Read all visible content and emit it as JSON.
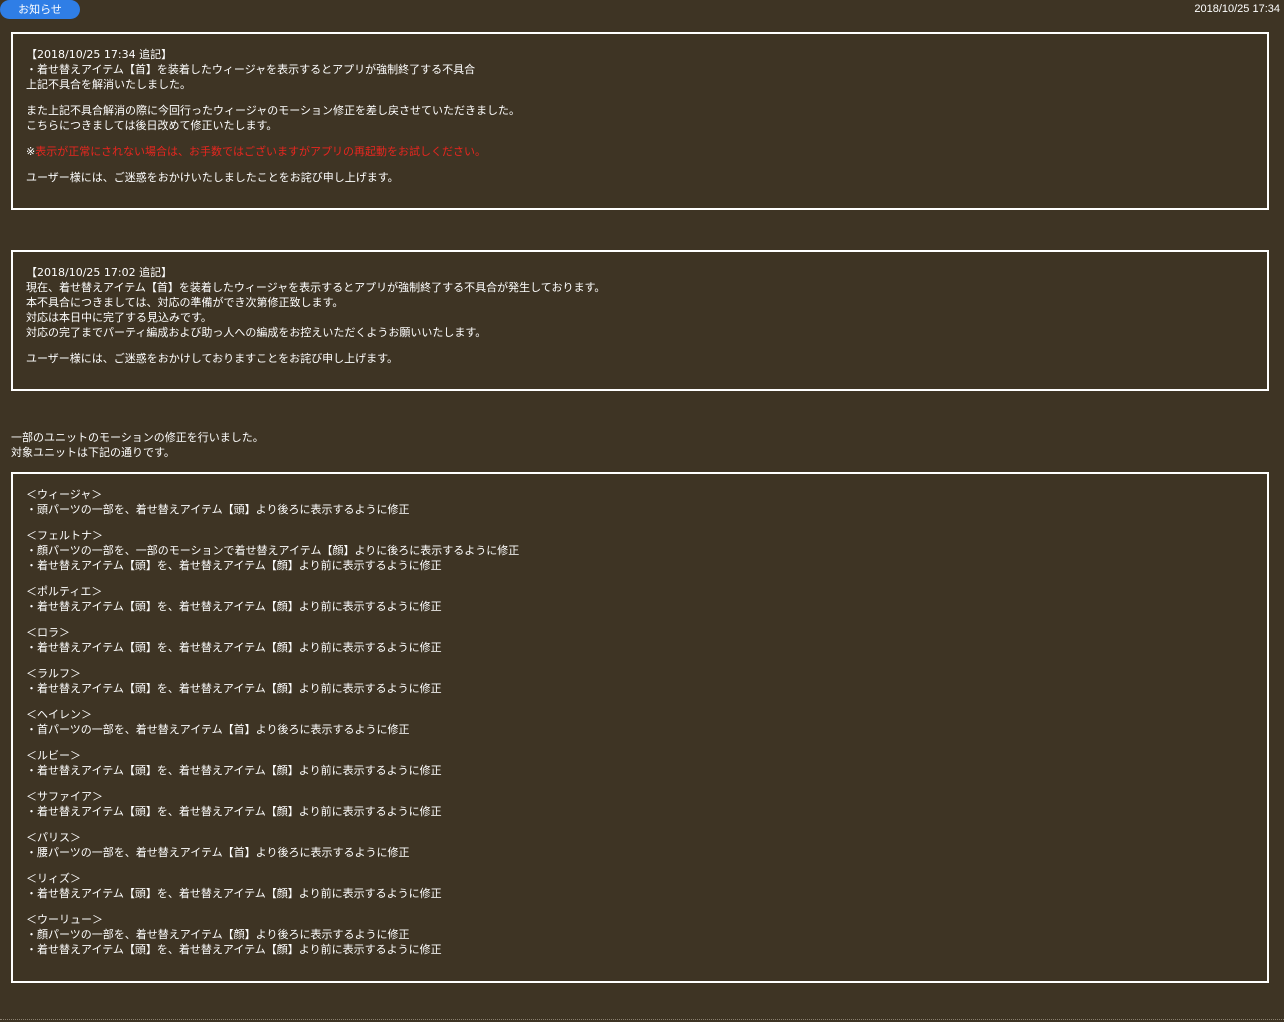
{
  "header": {
    "badge": "お知らせ",
    "date": "2018/10/25 17:34"
  },
  "notice1": {
    "lines_a": [
      "【2018/10/25 17:34 追記】",
      "・着せ替えアイテム【首】を装着したウィージャを表示するとアプリが強制終了する不具合",
      "上記不具合を解消いたしました。"
    ],
    "lines_b": [
      "また上記不具合解消の際に今回行ったウィージャのモーション修正を差し戻させていただきました。",
      "こちらにつきましては後日改めて修正いたします。"
    ],
    "note_mark": "※",
    "note_text": "表示が正常にされない場合は、お手数ではございますがアプリの再起動をお試しください。",
    "apology": "ユーザー様には、ご迷惑をおかけいたしましたことをお詫び申し上げます。"
  },
  "notice2": {
    "lines": [
      "【2018/10/25 17:02 追記】",
      "現在、着せ替えアイテム【首】を装着したウィージャを表示するとアプリが強制終了する不具合が発生しております。",
      "本不具合につきましては、対応の準備ができ次第修正致します。",
      "対応は本日中に完了する見込みです。",
      "対応の完了までパーティ編成および助っ人への編成をお控えいただくようお願いいたします。"
    ],
    "apology": "ユーザー様には、ご迷惑をおかけしておりますことをお詫び申し上げます。"
  },
  "intro": {
    "lines": [
      "一部のユニットのモーションの修正を行いました。",
      "対象ユニットは下記の通りです。"
    ]
  },
  "units": [
    {
      "name": "＜ウィージャ＞",
      "fixes": [
        "・頭パーツの一部を、着せ替えアイテム【頭】より後ろに表示するように修正"
      ]
    },
    {
      "name": "＜フェルトナ＞",
      "fixes": [
        "・顔パーツの一部を、一部のモーションで着せ替えアイテム【顔】よりに後ろに表示するように修正",
        "・着せ替えアイテム【頭】を、着せ替えアイテム【顔】より前に表示するように修正"
      ]
    },
    {
      "name": "＜ポルティエ＞",
      "fixes": [
        "・着せ替えアイテム【頭】を、着せ替えアイテム【顔】より前に表示するように修正"
      ]
    },
    {
      "name": "＜ロラ＞",
      "fixes": [
        "・着せ替えアイテム【頭】を、着せ替えアイテム【顔】より前に表示するように修正"
      ]
    },
    {
      "name": "＜ラルフ＞",
      "fixes": [
        "・着せ替えアイテム【頭】を、着せ替えアイテム【顔】より前に表示するように修正"
      ]
    },
    {
      "name": "＜ヘイレン＞",
      "fixes": [
        "・首パーツの一部を、着せ替えアイテム【首】より後ろに表示するように修正"
      ]
    },
    {
      "name": "＜ルビー＞",
      "fixes": [
        "・着せ替えアイテム【頭】を、着せ替えアイテム【顔】より前に表示するように修正"
      ]
    },
    {
      "name": "＜サファイア＞",
      "fixes": [
        "・着せ替えアイテム【頭】を、着せ替えアイテム【顔】より前に表示するように修正"
      ]
    },
    {
      "name": "＜パリス＞",
      "fixes": [
        "・腰パーツの一部を、着せ替えアイテム【首】より後ろに表示するように修正"
      ]
    },
    {
      "name": "＜リィズ＞",
      "fixes": [
        "・着せ替えアイテム【頭】を、着せ替えアイテム【顔】より前に表示するように修正"
      ]
    },
    {
      "name": "＜ウーリュー＞",
      "fixes": [
        "・顔パーツの一部を、着せ替えアイテム【顔】より後ろに表示するように修正",
        "・着せ替えアイテム【頭】を、着せ替えアイテム【顔】より前に表示するように修正"
      ]
    }
  ]
}
